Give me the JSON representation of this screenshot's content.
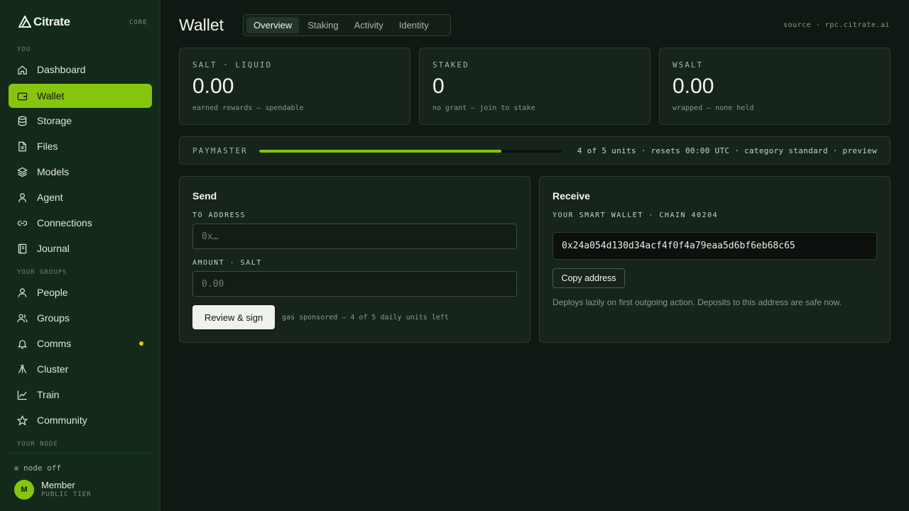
{
  "sidebar": {
    "brand": "Citrate",
    "tag": "CORE",
    "sections": {
      "you": "YOU",
      "groups": "YOUR GROUPS",
      "node": "YOUR NODE"
    },
    "items": [
      {
        "label": "Dashboard",
        "icon": "home-icon"
      },
      {
        "label": "Wallet",
        "icon": "wallet-icon",
        "active": true
      },
      {
        "label": "Storage",
        "icon": "database-icon"
      },
      {
        "label": "Files",
        "icon": "file-icon"
      },
      {
        "label": "Models",
        "icon": "layers-icon"
      },
      {
        "label": "Agent",
        "icon": "agent-icon"
      },
      {
        "label": "Connections",
        "icon": "link-icon"
      },
      {
        "label": "Journal",
        "icon": "journal-icon"
      },
      {
        "label": "People",
        "icon": "person-icon"
      },
      {
        "label": "Groups",
        "icon": "users-icon"
      },
      {
        "label": "Comms",
        "icon": "bell-icon",
        "badge_color": "#f2c31c"
      },
      {
        "label": "Cluster",
        "icon": "cluster-icon"
      },
      {
        "label": "Train",
        "icon": "chart-icon"
      },
      {
        "label": "Community",
        "icon": "star-icon"
      }
    ],
    "node_status": "node off",
    "user": {
      "initial": "M",
      "name": "Member",
      "tier": "PUBLIC TIER"
    }
  },
  "header": {
    "title": "Wallet",
    "tabs": [
      "Overview",
      "Staking",
      "Activity",
      "Identity"
    ],
    "active_tab": "Overview",
    "source": "source · rpc.citrate.ai"
  },
  "stats": [
    {
      "label": "SALT · LIQUID",
      "value": "0.00",
      "sub": "earned rewards — spendable"
    },
    {
      "label": "STAKED",
      "value": "0",
      "sub": "no grant — join to stake"
    },
    {
      "label": "WSALT",
      "value": "0.00",
      "sub": "wrapped — none held"
    }
  ],
  "paymaster": {
    "label": "PAYMASTER",
    "used": 4,
    "total": 5,
    "fill_fraction": 0.8,
    "text": "4 of 5 units · resets 00:00 UTC · category standard · preview"
  },
  "send": {
    "title": "Send",
    "to_label": "TO ADDRESS",
    "to_placeholder": "0x…",
    "amount_label": "AMOUNT · SALT",
    "amount_placeholder": "0.00",
    "button": "Review & sign",
    "note": "gas sponsored — 4 of 5 daily units left"
  },
  "receive": {
    "title": "Receive",
    "label": "YOUR SMART WALLET · CHAIN 40204",
    "address": "0x24a054d130d34acf4f0f4a79eaa5d6bf6eb68c65",
    "copy_button": "Copy address",
    "note": "Deploys lazily on first outgoing action. Deposits to this address are safe now."
  },
  "colors": {
    "accent": "#86c50d",
    "sidebar_bg": "#132a1a",
    "page_bg": "#0f1812",
    "notify": "#f2c31c"
  }
}
